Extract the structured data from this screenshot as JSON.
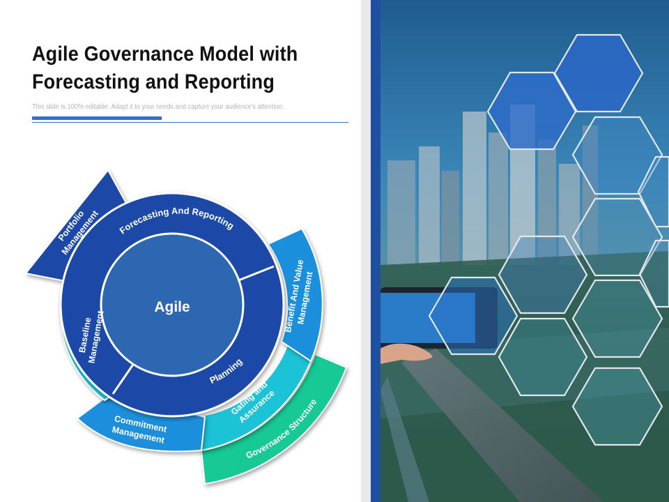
{
  "slide": {
    "title_line1": "Agile Governance Model with",
    "title_line2": "Forecasting and Reporting",
    "subtitle": "This slide is 100% editable. Adapt it to your needs and capture your audience's attention."
  },
  "diagram": {
    "center": "Agile",
    "inner_ring": {
      "top": "Forecasting And Reporting",
      "bottom": "Planning"
    },
    "outer_segments": {
      "portfolio": [
        "Portfolio",
        "Management"
      ],
      "baseline": [
        "Baseline",
        "Management"
      ],
      "commitment": [
        "Commitment",
        "Management"
      ],
      "gating": [
        "Gating and",
        "Assurance"
      ],
      "benefit": [
        "Benefit And Value",
        "Management"
      ],
      "governance": "Governance Structure"
    },
    "colors": {
      "dark_blue": "#1f4aa8",
      "center_blue": "#2e67b1",
      "cyan": "#1ec2d6",
      "green": "#19c995",
      "light_blue": "#1e8fdc"
    }
  }
}
